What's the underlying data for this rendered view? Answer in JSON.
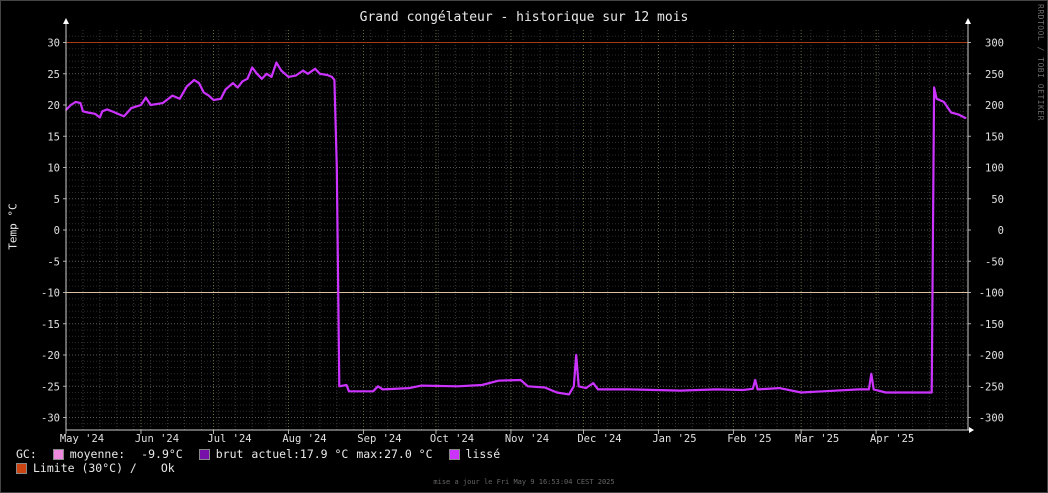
{
  "title": "Grand congélateur - historique sur 12 mois",
  "watermark": "RRDTOOL / TOBI OETIKER",
  "ylabel": "Temp °C",
  "legend": {
    "prefix": "GC:",
    "moyenne_label": "moyenne:",
    "moyenne_value": "-9.9°C",
    "brut_label": "brut",
    "actuel_label": "actuel:",
    "actuel_value": "17.9 °C",
    "max_label": "max:",
    "max_value": "27.0 °C",
    "lisse_label": "lissé",
    "limite_label": "Limite (30°C) /",
    "limite_status": "Ok"
  },
  "footer": "mise a jour le Fri May  9 16:53:04 CEST 2025",
  "colors": {
    "background": "#000000",
    "grid": "#5a5a5a",
    "line": "#cc33ff",
    "limit_line": "#a53a16",
    "zero_ref": "#e8e8e8",
    "moyenne_swatch": "#ee88dd",
    "brut_swatch": "#7711aa",
    "lisse_swatch": "#cc33ff",
    "limite_swatch": "#cc4411"
  },
  "chart_data": {
    "type": "line",
    "x_ticks": [
      "May '24",
      "Jun '24",
      "Jul '24",
      "Aug '24",
      "Sep '24",
      "Oct '24",
      "Nov '24",
      "Dec '24",
      "Jan '25",
      "Feb '25",
      "Mar '25",
      "Apr '25"
    ],
    "x_range": [
      "2024-05-01",
      "2025-05-09"
    ],
    "ylim": [
      -32,
      32
    ],
    "y_ticks_left": [
      30,
      25,
      20,
      15,
      10,
      5,
      0,
      -5,
      -10,
      -15,
      -20,
      -25,
      -30
    ],
    "y_ticks_right": [
      300,
      250,
      200,
      150,
      100,
      50,
      0,
      -50,
      -100,
      -150,
      -200,
      -250,
      -300
    ],
    "hlines": [
      30,
      -10
    ],
    "grid": true,
    "series": [
      {
        "name": "lissé",
        "points": [
          [
            "2024-05-01",
            19.2
          ],
          [
            "2024-05-03",
            20.0
          ],
          [
            "2024-05-05",
            20.5
          ],
          [
            "2024-05-07",
            20.3
          ],
          [
            "2024-05-08",
            19.0
          ],
          [
            "2024-05-10",
            18.8
          ],
          [
            "2024-05-13",
            18.6
          ],
          [
            "2024-05-15",
            18.0
          ],
          [
            "2024-05-16",
            19.0
          ],
          [
            "2024-05-18",
            19.3
          ],
          [
            "2024-05-20",
            19.0
          ],
          [
            "2024-05-23",
            18.5
          ],
          [
            "2024-05-25",
            18.2
          ],
          [
            "2024-05-28",
            19.5
          ],
          [
            "2024-06-01",
            20.0
          ],
          [
            "2024-06-03",
            21.2
          ],
          [
            "2024-06-05",
            20.0
          ],
          [
            "2024-06-10",
            20.3
          ],
          [
            "2024-06-14",
            21.5
          ],
          [
            "2024-06-17",
            21.0
          ],
          [
            "2024-06-20",
            23.0
          ],
          [
            "2024-06-23",
            24.0
          ],
          [
            "2024-06-25",
            23.5
          ],
          [
            "2024-06-27",
            22.0
          ],
          [
            "2024-06-29",
            21.5
          ],
          [
            "2024-07-01",
            20.8
          ],
          [
            "2024-07-04",
            21.0
          ],
          [
            "2024-07-06",
            22.5
          ],
          [
            "2024-07-09",
            23.5
          ],
          [
            "2024-07-11",
            22.8
          ],
          [
            "2024-07-13",
            23.8
          ],
          [
            "2024-07-15",
            24.2
          ],
          [
            "2024-07-17",
            26.0
          ],
          [
            "2024-07-19",
            25.0
          ],
          [
            "2024-07-21",
            24.2
          ],
          [
            "2024-07-23",
            25.0
          ],
          [
            "2024-07-25",
            24.5
          ],
          [
            "2024-07-27",
            26.8
          ],
          [
            "2024-07-29",
            25.5
          ],
          [
            "2024-08-01",
            24.5
          ],
          [
            "2024-08-04",
            24.7
          ],
          [
            "2024-08-07",
            25.5
          ],
          [
            "2024-08-09",
            25.0
          ],
          [
            "2024-08-12",
            25.8
          ],
          [
            "2024-08-14",
            25.0
          ],
          [
            "2024-08-17",
            24.8
          ],
          [
            "2024-08-19",
            24.5
          ],
          [
            "2024-08-20",
            24.0
          ],
          [
            "2024-08-21",
            10.0
          ],
          [
            "2024-08-22",
            -25.0
          ],
          [
            "2024-08-25",
            -24.8
          ],
          [
            "2024-08-26",
            -25.8
          ],
          [
            "2024-09-05",
            -25.8
          ],
          [
            "2024-09-07",
            -25.0
          ],
          [
            "2024-09-09",
            -25.5
          ],
          [
            "2024-09-20",
            -25.3
          ],
          [
            "2024-09-25",
            -24.9
          ],
          [
            "2024-10-10",
            -25.0
          ],
          [
            "2024-10-20",
            -24.8
          ],
          [
            "2024-10-27",
            -24.1
          ],
          [
            "2024-11-05",
            -24.0
          ],
          [
            "2024-11-08",
            -25.0
          ],
          [
            "2024-11-15",
            -25.2
          ],
          [
            "2024-11-20",
            -26.0
          ],
          [
            "2024-11-25",
            -26.3
          ],
          [
            "2024-11-27",
            -25.0
          ],
          [
            "2024-11-28",
            -20.0
          ],
          [
            "2024-11-29",
            -25.0
          ],
          [
            "2024-12-02",
            -25.3
          ],
          [
            "2024-12-05",
            -24.5
          ],
          [
            "2024-12-07",
            -25.5
          ],
          [
            "2024-12-20",
            -25.5
          ],
          [
            "2025-01-10",
            -25.7
          ],
          [
            "2025-01-25",
            -25.5
          ],
          [
            "2025-02-05",
            -25.6
          ],
          [
            "2025-02-09",
            -25.4
          ],
          [
            "2025-02-10",
            -24.0
          ],
          [
            "2025-02-11",
            -25.5
          ],
          [
            "2025-02-20",
            -25.3
          ],
          [
            "2025-03-01",
            -26.0
          ],
          [
            "2025-03-10",
            -25.8
          ],
          [
            "2025-03-25",
            -25.5
          ],
          [
            "2025-03-29",
            -25.5
          ],
          [
            "2025-03-30",
            -23.0
          ],
          [
            "2025-03-31",
            -25.5
          ],
          [
            "2025-04-05",
            -26.0
          ],
          [
            "2025-04-20",
            -26.0
          ],
          [
            "2025-04-24",
            -26.0
          ],
          [
            "2025-04-25",
            22.8
          ],
          [
            "2025-04-26",
            21.0
          ],
          [
            "2025-04-29",
            20.5
          ],
          [
            "2025-05-02",
            18.8
          ],
          [
            "2025-05-05",
            18.5
          ],
          [
            "2025-05-08",
            17.9
          ]
        ]
      }
    ]
  }
}
